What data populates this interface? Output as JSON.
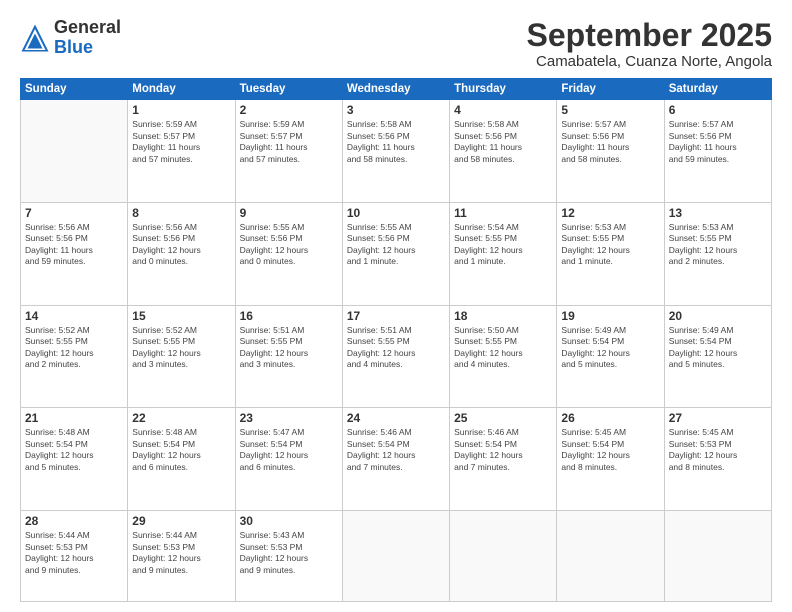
{
  "header": {
    "logo_general": "General",
    "logo_blue": "Blue",
    "month": "September 2025",
    "location": "Camabatela, Cuanza Norte, Angola"
  },
  "weekdays": [
    "Sunday",
    "Monday",
    "Tuesday",
    "Wednesday",
    "Thursday",
    "Friday",
    "Saturday"
  ],
  "weeks": [
    [
      {
        "day": "",
        "info": ""
      },
      {
        "day": "1",
        "info": "Sunrise: 5:59 AM\nSunset: 5:57 PM\nDaylight: 11 hours\nand 57 minutes."
      },
      {
        "day": "2",
        "info": "Sunrise: 5:59 AM\nSunset: 5:57 PM\nDaylight: 11 hours\nand 57 minutes."
      },
      {
        "day": "3",
        "info": "Sunrise: 5:58 AM\nSunset: 5:56 PM\nDaylight: 11 hours\nand 58 minutes."
      },
      {
        "day": "4",
        "info": "Sunrise: 5:58 AM\nSunset: 5:56 PM\nDaylight: 11 hours\nand 58 minutes."
      },
      {
        "day": "5",
        "info": "Sunrise: 5:57 AM\nSunset: 5:56 PM\nDaylight: 11 hours\nand 58 minutes."
      },
      {
        "day": "6",
        "info": "Sunrise: 5:57 AM\nSunset: 5:56 PM\nDaylight: 11 hours\nand 59 minutes."
      }
    ],
    [
      {
        "day": "7",
        "info": "Sunrise: 5:56 AM\nSunset: 5:56 PM\nDaylight: 11 hours\nand 59 minutes."
      },
      {
        "day": "8",
        "info": "Sunrise: 5:56 AM\nSunset: 5:56 PM\nDaylight: 12 hours\nand 0 minutes."
      },
      {
        "day": "9",
        "info": "Sunrise: 5:55 AM\nSunset: 5:56 PM\nDaylight: 12 hours\nand 0 minutes."
      },
      {
        "day": "10",
        "info": "Sunrise: 5:55 AM\nSunset: 5:56 PM\nDaylight: 12 hours\nand 1 minute."
      },
      {
        "day": "11",
        "info": "Sunrise: 5:54 AM\nSunset: 5:55 PM\nDaylight: 12 hours\nand 1 minute."
      },
      {
        "day": "12",
        "info": "Sunrise: 5:53 AM\nSunset: 5:55 PM\nDaylight: 12 hours\nand 1 minute."
      },
      {
        "day": "13",
        "info": "Sunrise: 5:53 AM\nSunset: 5:55 PM\nDaylight: 12 hours\nand 2 minutes."
      }
    ],
    [
      {
        "day": "14",
        "info": "Sunrise: 5:52 AM\nSunset: 5:55 PM\nDaylight: 12 hours\nand 2 minutes."
      },
      {
        "day": "15",
        "info": "Sunrise: 5:52 AM\nSunset: 5:55 PM\nDaylight: 12 hours\nand 3 minutes."
      },
      {
        "day": "16",
        "info": "Sunrise: 5:51 AM\nSunset: 5:55 PM\nDaylight: 12 hours\nand 3 minutes."
      },
      {
        "day": "17",
        "info": "Sunrise: 5:51 AM\nSunset: 5:55 PM\nDaylight: 12 hours\nand 4 minutes."
      },
      {
        "day": "18",
        "info": "Sunrise: 5:50 AM\nSunset: 5:55 PM\nDaylight: 12 hours\nand 4 minutes."
      },
      {
        "day": "19",
        "info": "Sunrise: 5:49 AM\nSunset: 5:54 PM\nDaylight: 12 hours\nand 5 minutes."
      },
      {
        "day": "20",
        "info": "Sunrise: 5:49 AM\nSunset: 5:54 PM\nDaylight: 12 hours\nand 5 minutes."
      }
    ],
    [
      {
        "day": "21",
        "info": "Sunrise: 5:48 AM\nSunset: 5:54 PM\nDaylight: 12 hours\nand 5 minutes."
      },
      {
        "day": "22",
        "info": "Sunrise: 5:48 AM\nSunset: 5:54 PM\nDaylight: 12 hours\nand 6 minutes."
      },
      {
        "day": "23",
        "info": "Sunrise: 5:47 AM\nSunset: 5:54 PM\nDaylight: 12 hours\nand 6 minutes."
      },
      {
        "day": "24",
        "info": "Sunrise: 5:46 AM\nSunset: 5:54 PM\nDaylight: 12 hours\nand 7 minutes."
      },
      {
        "day": "25",
        "info": "Sunrise: 5:46 AM\nSunset: 5:54 PM\nDaylight: 12 hours\nand 7 minutes."
      },
      {
        "day": "26",
        "info": "Sunrise: 5:45 AM\nSunset: 5:54 PM\nDaylight: 12 hours\nand 8 minutes."
      },
      {
        "day": "27",
        "info": "Sunrise: 5:45 AM\nSunset: 5:53 PM\nDaylight: 12 hours\nand 8 minutes."
      }
    ],
    [
      {
        "day": "28",
        "info": "Sunrise: 5:44 AM\nSunset: 5:53 PM\nDaylight: 12 hours\nand 9 minutes."
      },
      {
        "day": "29",
        "info": "Sunrise: 5:44 AM\nSunset: 5:53 PM\nDaylight: 12 hours\nand 9 minutes."
      },
      {
        "day": "30",
        "info": "Sunrise: 5:43 AM\nSunset: 5:53 PM\nDaylight: 12 hours\nand 9 minutes."
      },
      {
        "day": "",
        "info": ""
      },
      {
        "day": "",
        "info": ""
      },
      {
        "day": "",
        "info": ""
      },
      {
        "day": "",
        "info": ""
      }
    ]
  ]
}
